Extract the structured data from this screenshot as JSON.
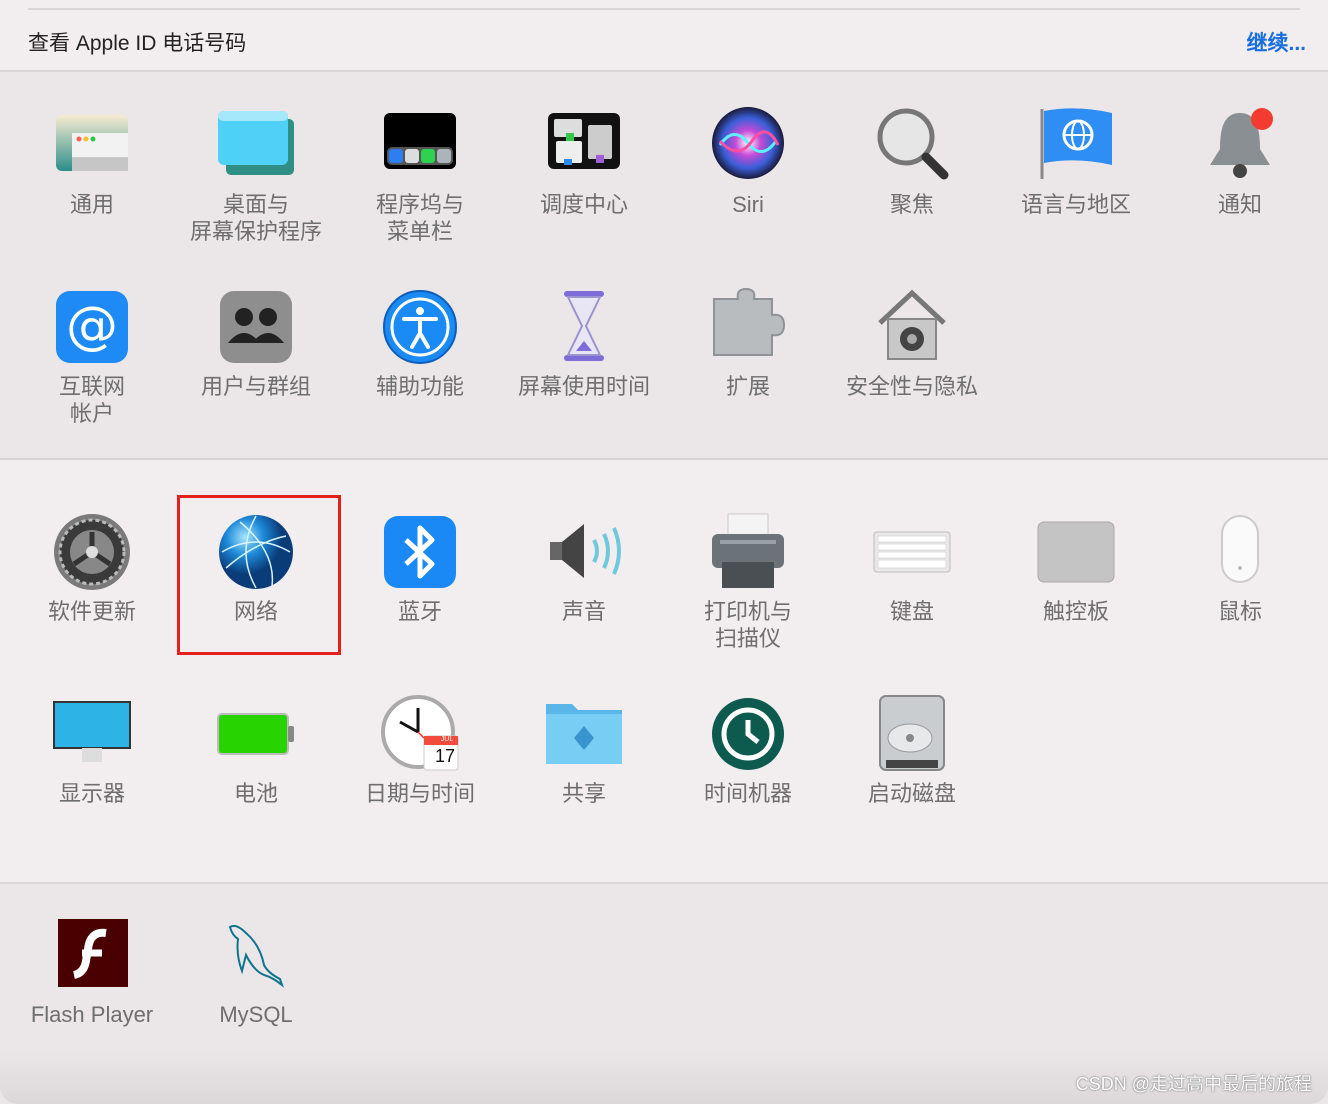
{
  "header": {
    "apple_id_text": "查看 Apple ID 电话号码",
    "continue_link": "继续..."
  },
  "sections": [
    {
      "rows": [
        [
          {
            "id": "general",
            "label": "通用",
            "icon": "general-icon"
          },
          {
            "id": "desktop-screensaver",
            "label": "桌面与\n屏幕保护程序",
            "icon": "desktop-icon"
          },
          {
            "id": "dock-menubar",
            "label": "程序坞与\n菜单栏",
            "icon": "dock-icon"
          },
          {
            "id": "mission-control",
            "label": "调度中心",
            "icon": "mission-control-icon"
          },
          {
            "id": "siri",
            "label": "Siri",
            "icon": "siri-icon"
          },
          {
            "id": "spotlight",
            "label": "聚焦",
            "icon": "spotlight-icon"
          },
          {
            "id": "language-region",
            "label": "语言与地区",
            "icon": "flag-globe-icon"
          },
          {
            "id": "notifications",
            "label": "通知",
            "icon": "bell-icon"
          }
        ],
        [
          {
            "id": "internet-accounts",
            "label": "互联网\n帐户",
            "icon": "at-icon"
          },
          {
            "id": "users-groups",
            "label": "用户与群组",
            "icon": "users-icon"
          },
          {
            "id": "accessibility",
            "label": "辅助功能",
            "icon": "accessibility-icon"
          },
          {
            "id": "screen-time",
            "label": "屏幕使用时间",
            "icon": "hourglass-icon"
          },
          {
            "id": "extensions",
            "label": "扩展",
            "icon": "puzzle-icon"
          },
          {
            "id": "security-privacy",
            "label": "安全性与隐私",
            "icon": "house-lock-icon"
          }
        ]
      ]
    },
    {
      "rows": [
        [
          {
            "id": "software-update",
            "label": "软件更新",
            "icon": "gear-icon"
          },
          {
            "id": "network",
            "label": "网络",
            "icon": "network-globe-icon"
          },
          {
            "id": "bluetooth",
            "label": "蓝牙",
            "icon": "bluetooth-icon"
          },
          {
            "id": "sound",
            "label": "声音",
            "icon": "speaker-icon"
          },
          {
            "id": "printers-scanners",
            "label": "打印机与\n扫描仪",
            "icon": "printer-icon"
          },
          {
            "id": "keyboard",
            "label": "键盘",
            "icon": "keyboard-icon"
          },
          {
            "id": "trackpad",
            "label": "触控板",
            "icon": "trackpad-icon"
          },
          {
            "id": "mouse",
            "label": "鼠标",
            "icon": "mouse-icon"
          }
        ],
        [
          {
            "id": "displays",
            "label": "显示器",
            "icon": "display-icon"
          },
          {
            "id": "battery",
            "label": "电池",
            "icon": "battery-icon"
          },
          {
            "id": "date-time",
            "label": "日期与时间",
            "icon": "clock-calendar-icon",
            "badge_month": "JUL",
            "badge_day": "17"
          },
          {
            "id": "sharing",
            "label": "共享",
            "icon": "folder-share-icon"
          },
          {
            "id": "time-machine",
            "label": "时间机器",
            "icon": "time-machine-icon"
          },
          {
            "id": "startup-disk",
            "label": "启动磁盘",
            "icon": "hard-disk-icon"
          }
        ]
      ]
    },
    {
      "rows": [
        [
          {
            "id": "flash-player",
            "label": "Flash Player",
            "icon": "flash-icon"
          },
          {
            "id": "mysql",
            "label": "MySQL",
            "icon": "dolphin-icon"
          }
        ]
      ]
    }
  ],
  "selected_item": "network",
  "highlight_color": "#e3201b",
  "accent_color": "#1a6fe0",
  "watermark": "CSDN @走过高中最后的旅程"
}
